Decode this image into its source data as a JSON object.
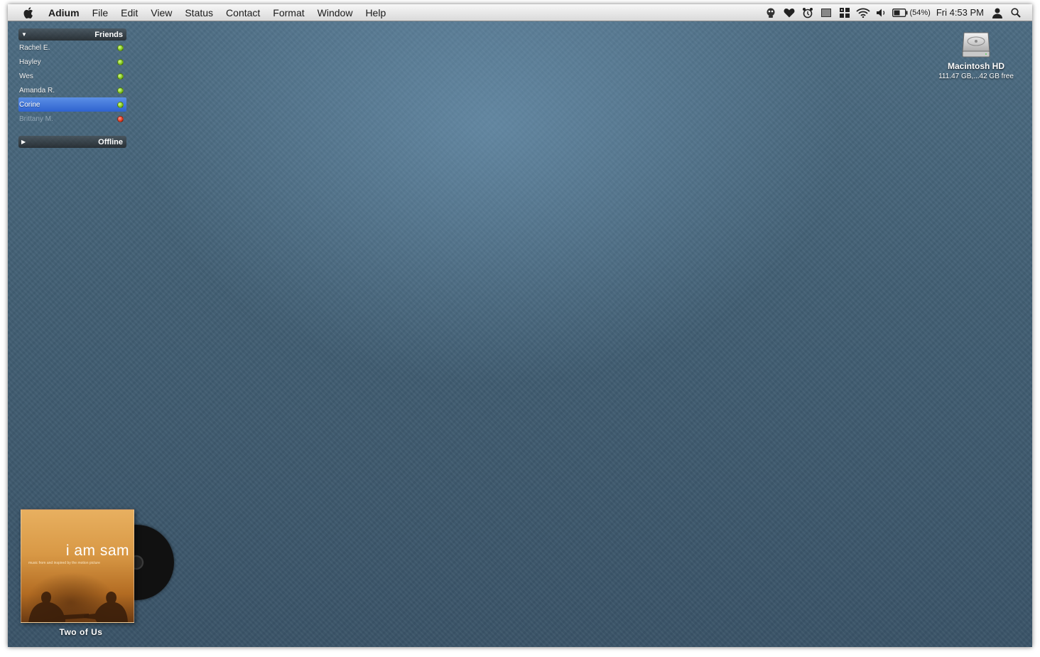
{
  "menubar": {
    "app_name": "Adium",
    "menus": [
      "File",
      "Edit",
      "View",
      "Status",
      "Contact",
      "Format",
      "Window",
      "Help"
    ],
    "battery_percent": "(54%)",
    "clock": "Fri 4:53 PM"
  },
  "contact_list": {
    "groups": [
      {
        "name": "Friends",
        "expanded": true,
        "contacts": [
          {
            "name": "Rachel E.",
            "status": "available"
          },
          {
            "name": "Hayley",
            "status": "available"
          },
          {
            "name": "Wes",
            "status": "available"
          },
          {
            "name": "Amanda R.",
            "status": "available"
          },
          {
            "name": "Corine",
            "status": "available",
            "selected": true
          },
          {
            "name": "Brittany M.",
            "status": "away"
          }
        ]
      },
      {
        "name": "Offline",
        "expanded": false
      }
    ]
  },
  "desktop": {
    "drive_name": "Macintosh HD",
    "drive_info": "111.47 GB,...42 GB free"
  },
  "now_playing": {
    "album_title": "i am sam",
    "album_subtitle": "music from and inspired by the motion picture",
    "track": "Two of Us"
  },
  "colors": {
    "available": "#7fc31c",
    "away": "#e23a1e",
    "selection": "#3a6fd8"
  }
}
